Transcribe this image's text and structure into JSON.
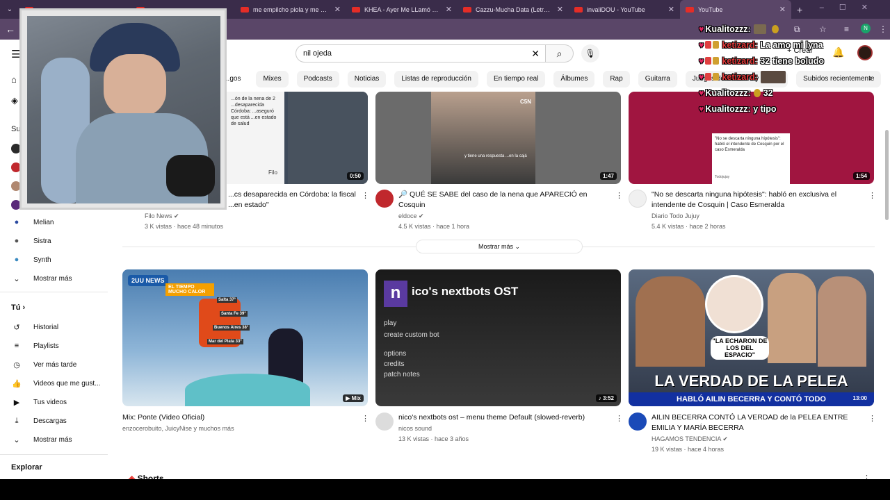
{
  "browser": {
    "tabs": [
      {
        "label": "",
        "active": false
      },
      {
        "label": "",
        "active": false
      },
      {
        "label": "me empilcho piola y me perfu",
        "active": false
      },
      {
        "label": "KHEA - Ayer Me LLamó Mi Ex f",
        "active": false
      },
      {
        "label": "Cazzu-Mucha Data (Letra) - Yo",
        "active": false
      },
      {
        "label": "invaliDOU - YouTube",
        "active": false
      },
      {
        "label": "YouTube",
        "active": true
      }
    ],
    "new_tab": "+",
    "profile_initial": "N"
  },
  "youtube": {
    "search_value": "nil ojeda",
    "create_label": "Crear",
    "chips": [
      "...gos",
      "Mixes",
      "Podcasts",
      "Noticias",
      "Listas de reproducción",
      "En tiempo real",
      "Álbumes",
      "Rap",
      "Guitarra",
      "Juegos de aventura y acción",
      "Subidos recientemente"
    ]
  },
  "sidebar": {
    "subs_heading": "Su",
    "subs": [
      {
        "label": "Melian"
      },
      {
        "label": "Sistra"
      },
      {
        "label": "Synth"
      }
    ],
    "more_subs": "Mostrar más",
    "you_heading": "Tú",
    "you_items": [
      {
        "label": "Historial",
        "icon": "history-icon"
      },
      {
        "label": "Playlists",
        "icon": "playlist-icon"
      },
      {
        "label": "Ver más tarde",
        "icon": "clock-icon"
      },
      {
        "label": "Videos que me gust...",
        "icon": "thumbs-up-icon"
      },
      {
        "label": "Tus videos",
        "icon": "video-icon"
      },
      {
        "label": "Descargas",
        "icon": "download-icon"
      }
    ],
    "more_you": "Mostrar más",
    "explore_heading": "Explorar"
  },
  "row1": [
    {
      "title_l1": "...cs desaparecida en Córdoba: la fiscal",
      "title_l2": "...en estado\"",
      "channel": "Filo News",
      "meta": "3 K vistas · hace 48 minutos",
      "duration": "0:50",
      "thumb_text": "...ón de la nena de 2 ...desaparecida Córdoba: ...aseguró que está ...en estado de salud",
      "thumb_label": "Filo"
    },
    {
      "title_l1": "🔎 QUÉ SE SABE del caso de la nena que APARECIÓ en",
      "title_l2": "Cosquin",
      "channel": "eldoce",
      "meta": "4.5 K vistas · hace 1 hora",
      "duration": "1:47",
      "thumb_text": "y tiene una respuesta ...en la cajá",
      "thumb_label": "C5N"
    },
    {
      "title_l1": "\"No se descarta ninguna hipótesis\": habló en exclusiva el",
      "title_l2": "intendente de Cosquin | Caso Esmeralda",
      "channel": "Diario Todo Jujuy",
      "meta": "5.4 K vistas · hace 2 horas",
      "duration": "1:54",
      "thumb_text": "\"No se descarta ninguna hipótesis\": habló el intendente de Cosquin por el caso Esmeralda",
      "thumb_label": "Todojujuy"
    }
  ],
  "show_more": "Mostrar más",
  "row2": [
    {
      "title_l1": "Mix: Ponte (Video Oficial)",
      "title_l2": "",
      "channel": "enzocerobuito, JuicyNise y muchos más",
      "meta": "",
      "duration": "Mix",
      "thumb_text": "EL TIEMPO MUCHO CALOR",
      "thumb_label": "2UU NEWS",
      "temps": [
        "Salta 37°",
        "Santa Fe 39°",
        "Buenos Aires 38°",
        "Mar del Plata 33°"
      ]
    },
    {
      "title_l1": "nico's nextbots ost – menu theme Default (slowed-reverb)",
      "title_l2": "",
      "channel": "nicos sound",
      "meta": "13 K vistas · hace 3 años",
      "duration": "3:52",
      "thumb_title": "ico's nextbots OST",
      "thumb_menu": [
        "play",
        "create custom bot",
        "options",
        "credits",
        "patch notes"
      ],
      "thumb_label": "n"
    },
    {
      "title_l1": "AILIN BECERRA CONTÓ LA VERDAD de la PELEA ENTRE",
      "title_l2": "EMILIA Y MARÍA BECERRA",
      "channel": "HAGAMOS TENDENCIA",
      "meta": "19 K vistas · hace 4 horas",
      "duration": "13:00",
      "thumb_big": "LA VERDAD DE LA PELEA",
      "thumb_sub": "HABLÓ AILIN BECERRA Y CONTÓ TODO",
      "thumb_quote": "\"LA ECHARON DE LOS DEL ESPACIO\""
    }
  ],
  "shorts_label": "Shorts",
  "chat": [
    {
      "user": "Kualitozzz:",
      "text": "",
      "badges": "heart",
      "color": "#ffffff"
    },
    {
      "user": "ketizard:",
      "text": "La amo mi lyna",
      "badges": "heart-sub",
      "color": "#e03a3a"
    },
    {
      "user": "ketizard:",
      "text": "32 tiene boludo",
      "badges": "heart-sub",
      "color": "#e03a3a"
    },
    {
      "user": "ketizard:",
      "text": "",
      "badges": "heart-sub",
      "color": "#e03a3a"
    },
    {
      "user": "Kualitozzz:",
      "text": "32",
      "badges": "heart",
      "color": "#ffffff"
    },
    {
      "user": "Kualitozzz:",
      "text": "y tipo",
      "badges": "heart",
      "color": "#ffffff"
    }
  ]
}
